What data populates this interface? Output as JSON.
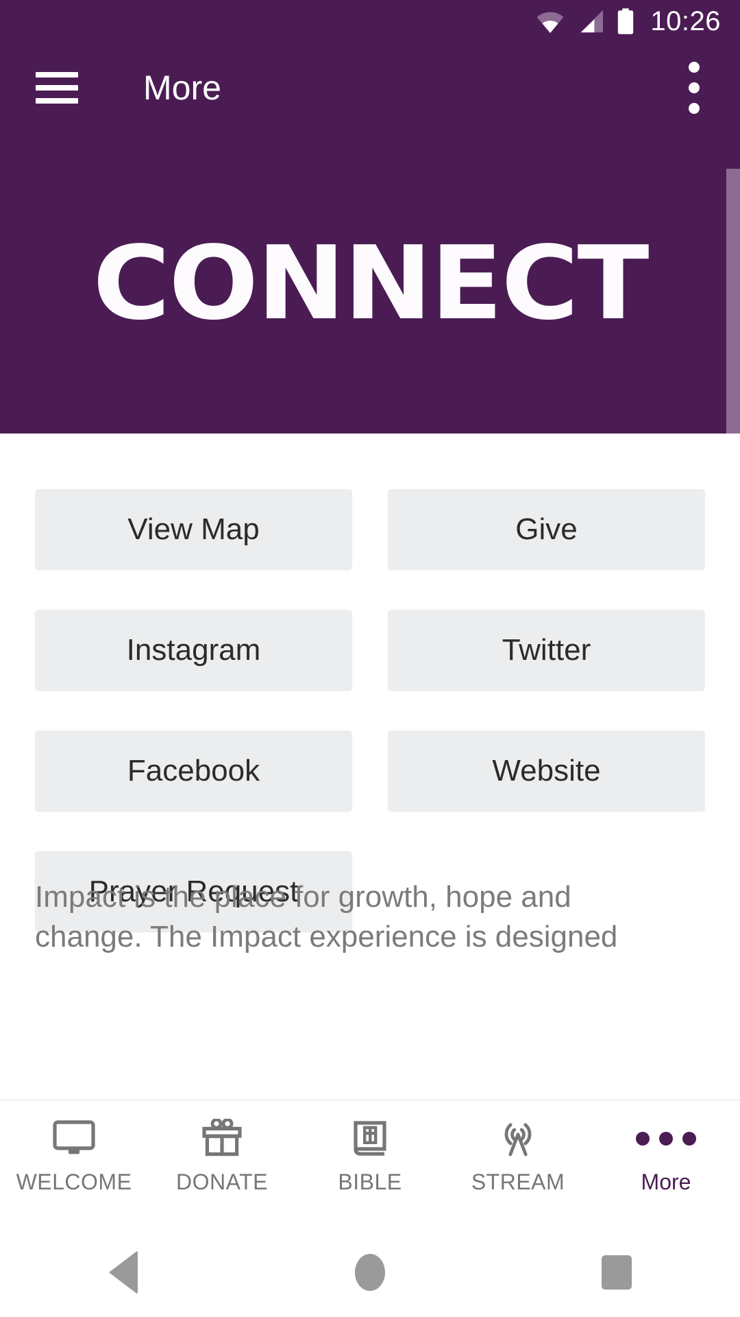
{
  "status_bar": {
    "time": "10:26",
    "icons": [
      "wifi-icon",
      "cellular-signal-icon",
      "battery-icon"
    ]
  },
  "app_bar": {
    "menu_icon": "hamburger-menu-icon",
    "title": "More",
    "overflow_icon": "overflow-menu-icon"
  },
  "banner": {
    "word": "CONNECT",
    "background_color": "#4b1c54"
  },
  "content": {
    "buttons": [
      {
        "label": "View Map"
      },
      {
        "label": "Give"
      },
      {
        "label": "Instagram"
      },
      {
        "label": "Twitter"
      },
      {
        "label": "Facebook"
      },
      {
        "label": "Website"
      },
      {
        "label": "Prayer Request"
      }
    ],
    "blurb": "Impact is the place for growth, hope and change. The Impact experience is designed"
  },
  "tab_bar": {
    "tabs": [
      {
        "label": "WELCOME",
        "icon": "monitor-icon",
        "active": false
      },
      {
        "label": "DONATE",
        "icon": "gift-icon",
        "active": false
      },
      {
        "label": "BIBLE",
        "icon": "bible-book-icon",
        "active": false
      },
      {
        "label": "STREAM",
        "icon": "broadcast-tower-icon",
        "active": false
      },
      {
        "label": "More",
        "icon": "three-dots-icon",
        "active": true
      }
    ]
  },
  "nav_bar": {
    "back": "back-triangle-icon",
    "home": "home-circle-icon",
    "recents": "recents-square-icon"
  },
  "colors": {
    "brand_purple": "#4b1c54",
    "button_gray": "#ebedee",
    "text_dark": "#2b2b2b",
    "text_muted": "#7b7b7b",
    "tab_inactive": "#767676"
  }
}
